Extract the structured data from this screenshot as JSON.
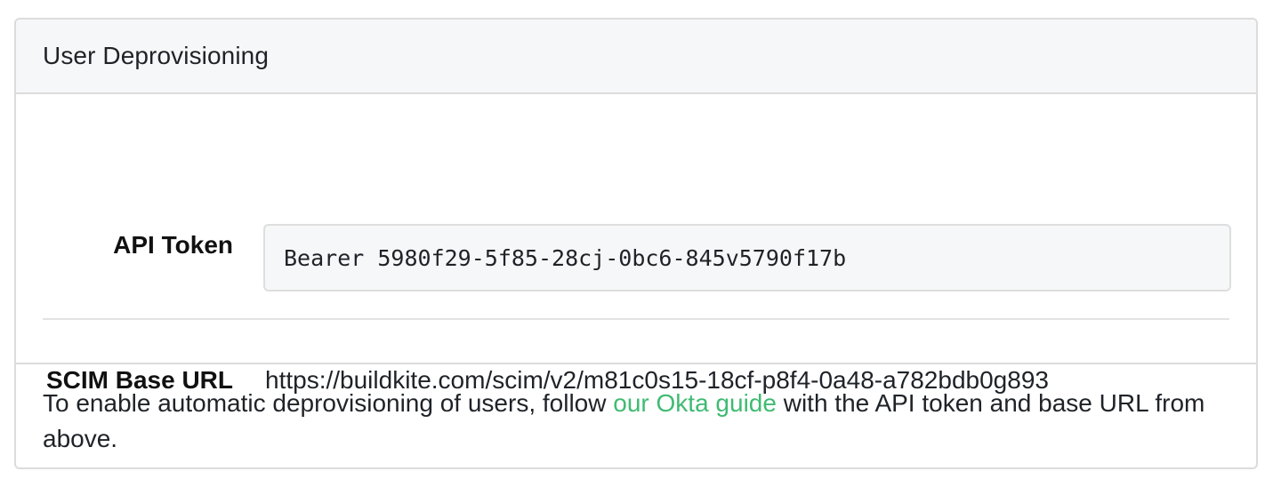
{
  "panel": {
    "title": "User Deprovisioning"
  },
  "api_token": {
    "label": "API Token",
    "value": "Bearer 5980f29-5f85-28cj-0bc6-845v5790f17b"
  },
  "scim": {
    "label": "SCIM Base URL",
    "url": "https://buildkite.com/scim/v2/m81c0s15-18cf-p8f4-0a48-a782bdb0g893"
  },
  "footer": {
    "text_before": "To enable automatic deprovisioning of users, follow ",
    "link_text": "our Okta guide",
    "text_after": " with the API token and base URL from above."
  },
  "colors": {
    "link": "#3fbb72",
    "header_bg": "#f6f7f8",
    "border": "#dcdcdc"
  }
}
